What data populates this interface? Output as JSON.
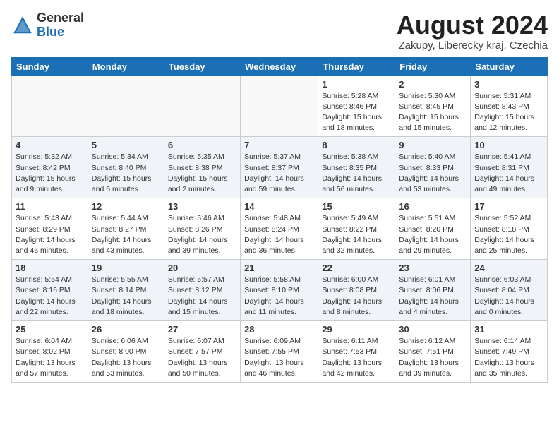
{
  "logo": {
    "general": "General",
    "blue": "Blue"
  },
  "title": {
    "month_year": "August 2024",
    "location": "Zakupy, Liberecky kraj, Czechia"
  },
  "weekdays": [
    "Sunday",
    "Monday",
    "Tuesday",
    "Wednesday",
    "Thursday",
    "Friday",
    "Saturday"
  ],
  "weeks": [
    [
      {
        "day": "",
        "info": ""
      },
      {
        "day": "",
        "info": ""
      },
      {
        "day": "",
        "info": ""
      },
      {
        "day": "",
        "info": ""
      },
      {
        "day": "1",
        "info": "Sunrise: 5:28 AM\nSunset: 8:46 PM\nDaylight: 15 hours\nand 18 minutes."
      },
      {
        "day": "2",
        "info": "Sunrise: 5:30 AM\nSunset: 8:45 PM\nDaylight: 15 hours\nand 15 minutes."
      },
      {
        "day": "3",
        "info": "Sunrise: 5:31 AM\nSunset: 8:43 PM\nDaylight: 15 hours\nand 12 minutes."
      }
    ],
    [
      {
        "day": "4",
        "info": "Sunrise: 5:32 AM\nSunset: 8:42 PM\nDaylight: 15 hours\nand 9 minutes."
      },
      {
        "day": "5",
        "info": "Sunrise: 5:34 AM\nSunset: 8:40 PM\nDaylight: 15 hours\nand 6 minutes."
      },
      {
        "day": "6",
        "info": "Sunrise: 5:35 AM\nSunset: 8:38 PM\nDaylight: 15 hours\nand 2 minutes."
      },
      {
        "day": "7",
        "info": "Sunrise: 5:37 AM\nSunset: 8:37 PM\nDaylight: 14 hours\nand 59 minutes."
      },
      {
        "day": "8",
        "info": "Sunrise: 5:38 AM\nSunset: 8:35 PM\nDaylight: 14 hours\nand 56 minutes."
      },
      {
        "day": "9",
        "info": "Sunrise: 5:40 AM\nSunset: 8:33 PM\nDaylight: 14 hours\nand 53 minutes."
      },
      {
        "day": "10",
        "info": "Sunrise: 5:41 AM\nSunset: 8:31 PM\nDaylight: 14 hours\nand 49 minutes."
      }
    ],
    [
      {
        "day": "11",
        "info": "Sunrise: 5:43 AM\nSunset: 8:29 PM\nDaylight: 14 hours\nand 46 minutes."
      },
      {
        "day": "12",
        "info": "Sunrise: 5:44 AM\nSunset: 8:27 PM\nDaylight: 14 hours\nand 43 minutes."
      },
      {
        "day": "13",
        "info": "Sunrise: 5:46 AM\nSunset: 8:26 PM\nDaylight: 14 hours\nand 39 minutes."
      },
      {
        "day": "14",
        "info": "Sunrise: 5:48 AM\nSunset: 8:24 PM\nDaylight: 14 hours\nand 36 minutes."
      },
      {
        "day": "15",
        "info": "Sunrise: 5:49 AM\nSunset: 8:22 PM\nDaylight: 14 hours\nand 32 minutes."
      },
      {
        "day": "16",
        "info": "Sunrise: 5:51 AM\nSunset: 8:20 PM\nDaylight: 14 hours\nand 29 minutes."
      },
      {
        "day": "17",
        "info": "Sunrise: 5:52 AM\nSunset: 8:18 PM\nDaylight: 14 hours\nand 25 minutes."
      }
    ],
    [
      {
        "day": "18",
        "info": "Sunrise: 5:54 AM\nSunset: 8:16 PM\nDaylight: 14 hours\nand 22 minutes."
      },
      {
        "day": "19",
        "info": "Sunrise: 5:55 AM\nSunset: 8:14 PM\nDaylight: 14 hours\nand 18 minutes."
      },
      {
        "day": "20",
        "info": "Sunrise: 5:57 AM\nSunset: 8:12 PM\nDaylight: 14 hours\nand 15 minutes."
      },
      {
        "day": "21",
        "info": "Sunrise: 5:58 AM\nSunset: 8:10 PM\nDaylight: 14 hours\nand 11 minutes."
      },
      {
        "day": "22",
        "info": "Sunrise: 6:00 AM\nSunset: 8:08 PM\nDaylight: 14 hours\nand 8 minutes."
      },
      {
        "day": "23",
        "info": "Sunrise: 6:01 AM\nSunset: 8:06 PM\nDaylight: 14 hours\nand 4 minutes."
      },
      {
        "day": "24",
        "info": "Sunrise: 6:03 AM\nSunset: 8:04 PM\nDaylight: 14 hours\nand 0 minutes."
      }
    ],
    [
      {
        "day": "25",
        "info": "Sunrise: 6:04 AM\nSunset: 8:02 PM\nDaylight: 13 hours\nand 57 minutes."
      },
      {
        "day": "26",
        "info": "Sunrise: 6:06 AM\nSunset: 8:00 PM\nDaylight: 13 hours\nand 53 minutes."
      },
      {
        "day": "27",
        "info": "Sunrise: 6:07 AM\nSunset: 7:57 PM\nDaylight: 13 hours\nand 50 minutes."
      },
      {
        "day": "28",
        "info": "Sunrise: 6:09 AM\nSunset: 7:55 PM\nDaylight: 13 hours\nand 46 minutes."
      },
      {
        "day": "29",
        "info": "Sunrise: 6:11 AM\nSunset: 7:53 PM\nDaylight: 13 hours\nand 42 minutes."
      },
      {
        "day": "30",
        "info": "Sunrise: 6:12 AM\nSunset: 7:51 PM\nDaylight: 13 hours\nand 39 minutes."
      },
      {
        "day": "31",
        "info": "Sunrise: 6:14 AM\nSunset: 7:49 PM\nDaylight: 13 hours\nand 35 minutes."
      }
    ]
  ]
}
